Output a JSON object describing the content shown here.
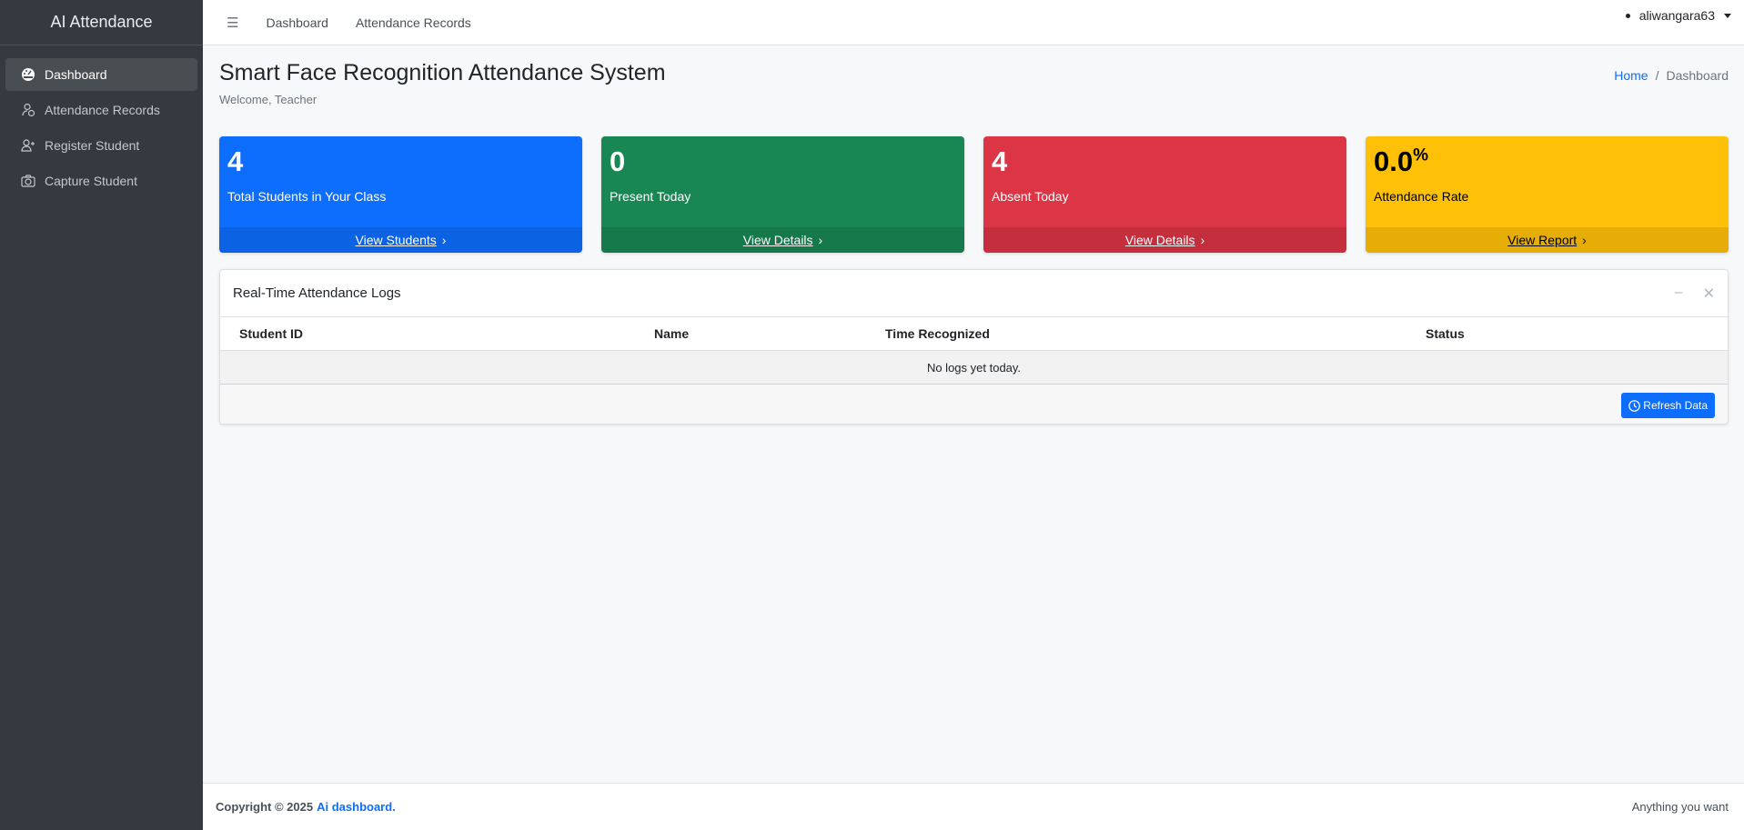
{
  "brand": "AI Attendance",
  "sidebar": {
    "items": [
      {
        "label": "Dashboard",
        "icon": "dashboard-gauge-icon"
      },
      {
        "label": "Attendance Records",
        "icon": "user-check-icon"
      },
      {
        "label": "Register Student",
        "icon": "user-plus-icon"
      },
      {
        "label": "Capture Student",
        "icon": "camera-icon"
      }
    ]
  },
  "topbar": {
    "menu": "☰",
    "links": [
      "Dashboard",
      "Attendance Records"
    ],
    "user": "aliwangara63"
  },
  "page": {
    "title": "Smart Face Recognition Attendance System",
    "welcome": "Welcome, Teacher",
    "breadcrumb": {
      "home": "Home",
      "sep": "/",
      "current": "Dashboard"
    }
  },
  "cards": [
    {
      "value": "4",
      "label": "Total Students in Your Class",
      "link": "View Students",
      "color": "#0d6efd"
    },
    {
      "value": "0",
      "label": "Present Today",
      "link": "View Details",
      "color": "#198754"
    },
    {
      "value": "4",
      "label": "Absent Today",
      "link": "View Details",
      "color": "#dc3545"
    },
    {
      "value": "0.0",
      "suffix": "%",
      "label": "Attendance Rate",
      "link": "View Report",
      "color": "#ffc107"
    }
  ],
  "logs": {
    "title": "Real-Time Attendance Logs",
    "columns": [
      "Student ID",
      "Name",
      "Time Recognized",
      "Status"
    ],
    "empty": "No logs yet today.",
    "refresh": "Refresh Data"
  },
  "footer": {
    "copyright": "Copyright © 2025",
    "link": "Ai dashboard.",
    "right": "Anything you want"
  }
}
